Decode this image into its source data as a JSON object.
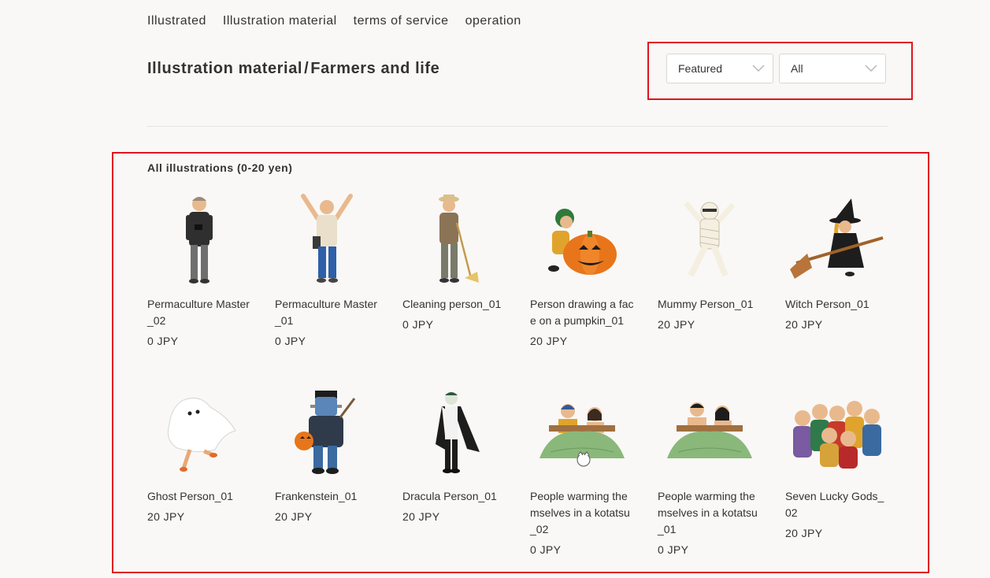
{
  "nav": {
    "items": [
      "Illustrated",
      "Illustration material",
      "terms of service",
      "operation"
    ]
  },
  "header": {
    "breadcrumb_parent": "Illustration material",
    "separator": "/",
    "breadcrumb_current": "Farmers and life"
  },
  "filters": {
    "sort_selected": "Featured",
    "category_selected": "All"
  },
  "section": {
    "title": "All illustrations (0-20 yen)"
  },
  "items": [
    {
      "name": "Permaculture Master_02",
      "price": "0 JPY",
      "icon": "old-man-camera-illustration"
    },
    {
      "name": "Permaculture Master_01",
      "price": "0 JPY",
      "icon": "old-man-arms-raised-illustration"
    },
    {
      "name": "Cleaning person_01",
      "price": "0 JPY",
      "icon": "person-with-rake-illustration"
    },
    {
      "name": "Person drawing a face on a pumpkin_01",
      "price": "20 JPY",
      "icon": "pumpkin-carving-illustration"
    },
    {
      "name": "Mummy Person_01",
      "price": "20 JPY",
      "icon": "mummy-illustration"
    },
    {
      "name": "Witch Person_01",
      "price": "20 JPY",
      "icon": "witch-on-broom-illustration"
    },
    {
      "name": "Ghost Person_01",
      "price": "20 JPY",
      "icon": "ghost-illustration"
    },
    {
      "name": "Frankenstein_01",
      "price": "20 JPY",
      "icon": "frankenstein-illustration"
    },
    {
      "name": "Dracula Person_01",
      "price": "20 JPY",
      "icon": "dracula-illustration"
    },
    {
      "name": "People warming themselves in a kotatsu_02",
      "price": "0 JPY",
      "icon": "kotatsu-cat-illustration"
    },
    {
      "name": "People warming themselves in a kotatsu_01",
      "price": "0 JPY",
      "icon": "kotatsu-illustration"
    },
    {
      "name": "Seven Lucky Gods_02",
      "price": "20 JPY",
      "icon": "seven-lucky-gods-illustration"
    }
  ],
  "colors": {
    "highlight_border": "#e0141e",
    "background": "#f9f8f6"
  }
}
